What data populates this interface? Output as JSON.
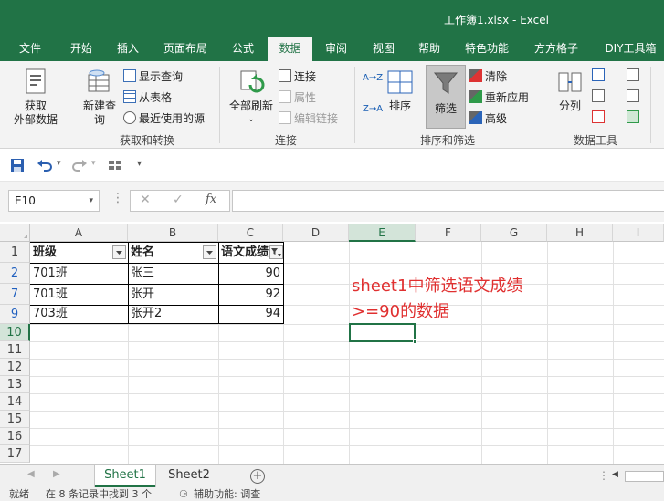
{
  "window": {
    "title": "工作簿1.xlsx  -  Excel"
  },
  "tabs": [
    {
      "label": "文件",
      "active": false
    },
    {
      "label": "开始",
      "active": false
    },
    {
      "label": "插入",
      "active": false
    },
    {
      "label": "页面布局",
      "active": false
    },
    {
      "label": "公式",
      "active": false
    },
    {
      "label": "数据",
      "active": true
    },
    {
      "label": "审阅",
      "active": false
    },
    {
      "label": "视图",
      "active": false
    },
    {
      "label": "帮助",
      "active": false
    },
    {
      "label": "特色功能",
      "active": false
    },
    {
      "label": "方方格子",
      "active": false
    },
    {
      "label": "DIY工具箱",
      "active": false
    }
  ],
  "ribbon": {
    "get_external_1": "获取",
    "get_external_2": "外部数据",
    "new_query_1": "新建查",
    "new_query_2": "询",
    "show_query": "显示查询",
    "from_table": "从表格",
    "recent_sources": "最近使用的源",
    "group_get_transform": "获取和转换",
    "refresh_all": "全部刷新",
    "connections": "连接",
    "properties": "属性",
    "edit_links": "编辑链接",
    "group_connections": "连接",
    "sort_asc": "A→Z",
    "sort_desc": "Z→A",
    "sort": "排序",
    "filter": "筛选",
    "clear": "清除",
    "reapply": "重新应用",
    "advanced": "高级",
    "group_sort_filter": "排序和筛选",
    "text_to_columns": "分列",
    "group_data_tools": "数据工具"
  },
  "formula_bar": {
    "name_box": "E10",
    "fx": "fx",
    "value": ""
  },
  "columns": [
    "A",
    "B",
    "C",
    "D",
    "E",
    "F",
    "G",
    "H",
    "I"
  ],
  "selected_column": "E",
  "rows": [
    {
      "num": "1",
      "cells": [
        "班级",
        "姓名",
        "语文成绩"
      ]
    },
    {
      "num": "2",
      "cells": [
        "701班",
        "张三",
        "90"
      ]
    },
    {
      "num": "7",
      "cells": [
        "701班",
        "张开",
        "92"
      ]
    },
    {
      "num": "9",
      "cells": [
        "703班",
        "张开2",
        "94"
      ]
    },
    {
      "num": "10",
      "cells": [
        "",
        "",
        ""
      ]
    },
    {
      "num": "11",
      "cells": [
        "",
        "",
        ""
      ]
    },
    {
      "num": "12",
      "cells": [
        "",
        "",
        ""
      ]
    },
    {
      "num": "13",
      "cells": [
        "",
        "",
        ""
      ]
    },
    {
      "num": "14",
      "cells": [
        "",
        "",
        ""
      ]
    },
    {
      "num": "15",
      "cells": [
        "",
        "",
        ""
      ]
    },
    {
      "num": "16",
      "cells": [
        "",
        "",
        ""
      ]
    },
    {
      "num": "17",
      "cells": [
        "",
        "",
        ""
      ]
    }
  ],
  "annotation": {
    "line1": "sheet1中筛选语文成绩",
    "line2": ">=90的数据"
  },
  "sheets": [
    {
      "label": "Sheet1",
      "active": true
    },
    {
      "label": "Sheet2",
      "active": false
    }
  ],
  "status": {
    "ready": "就绪",
    "found": "在 8 条记录中找到 3 个",
    "accessibility": "辅助功能: 调查"
  },
  "colors": {
    "accent": "#217346",
    "annotation": "#e03030",
    "filtered_row": "#1f5fbf"
  }
}
